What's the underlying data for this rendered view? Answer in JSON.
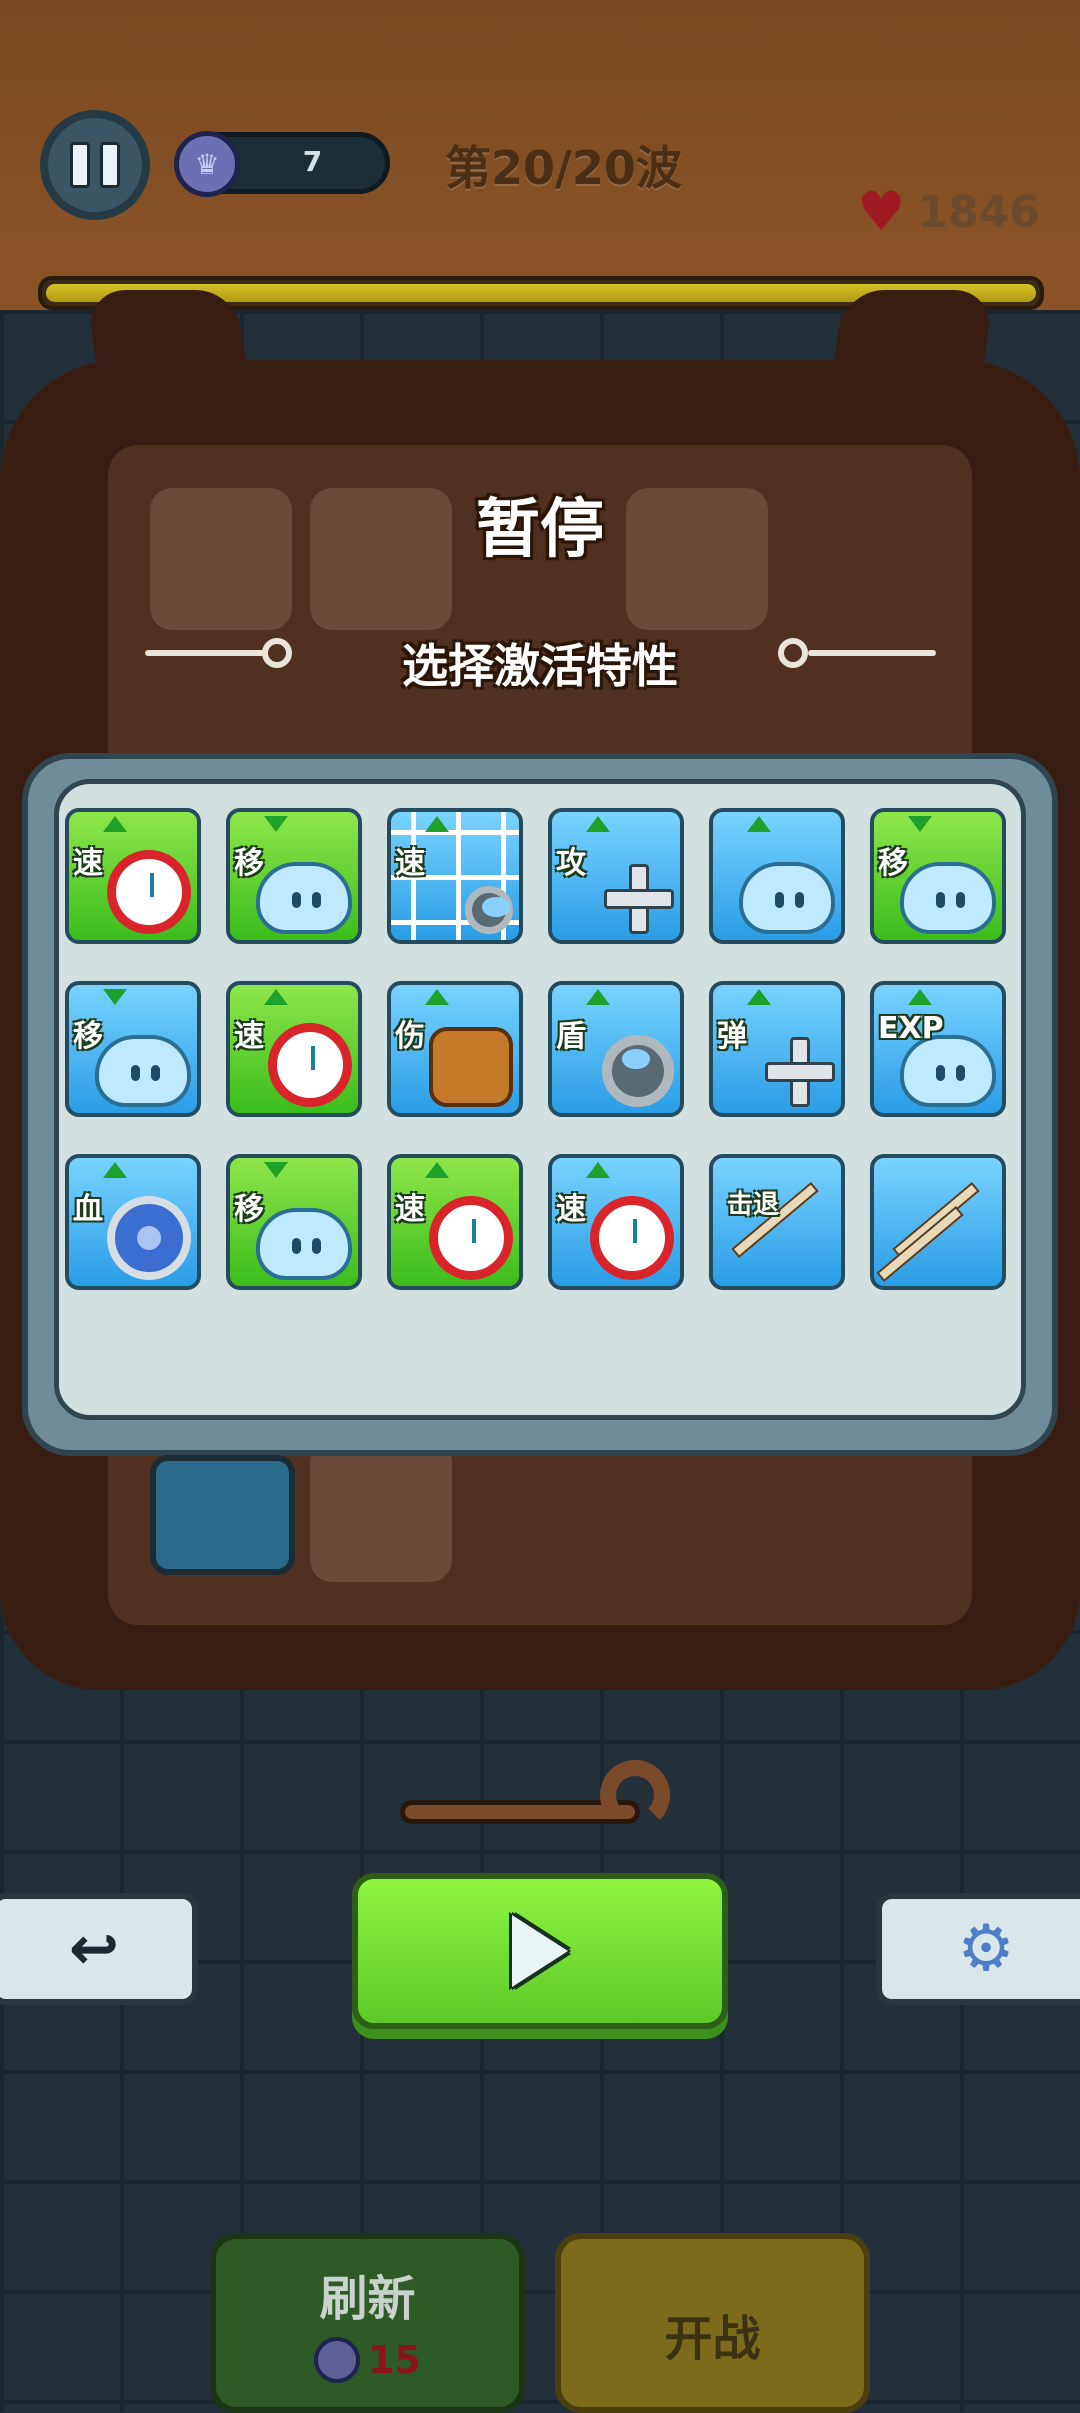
{
  "hud": {
    "crown_count": "7",
    "wave_text": "第20/20波",
    "hp_value": "1846",
    "progress_fraction": 1.0
  },
  "pause_menu": {
    "title": "暂停",
    "subtitle": "选择激活特性"
  },
  "traits": [
    {
      "label": "速",
      "icon": "clock-icon",
      "arrow": "up",
      "color": "green"
    },
    {
      "label": "移",
      "icon": "slime-icon",
      "arrow": "down",
      "color": "green"
    },
    {
      "label": "速",
      "icon": "grid-disc-icon",
      "arrow": "up",
      "color": "blue"
    },
    {
      "label": "攻",
      "icon": "shuriken-icon",
      "arrow": "up",
      "color": "blue"
    },
    {
      "label": "",
      "icon": "coin-slime-icon",
      "arrow": "up",
      "color": "blue"
    },
    {
      "label": "移",
      "icon": "slime-icon",
      "arrow": "down",
      "color": "green"
    },
    {
      "label": "移",
      "icon": "slime-icon",
      "arrow": "down",
      "color": "blue"
    },
    {
      "label": "速",
      "icon": "clock-icon",
      "arrow": "up",
      "color": "green"
    },
    {
      "label": "伤",
      "icon": "backpack-icon",
      "arrow": "up",
      "color": "blue"
    },
    {
      "label": "盾",
      "icon": "ring-icon",
      "arrow": "up",
      "color": "blue"
    },
    {
      "label": "弹",
      "icon": "shuriken-icon",
      "arrow": "up",
      "color": "blue"
    },
    {
      "label": "EXP",
      "icon": "slime-icon",
      "arrow": "up",
      "color": "blue"
    },
    {
      "label": "血",
      "icon": "shield-icon",
      "arrow": "up",
      "color": "blue"
    },
    {
      "label": "移",
      "icon": "slime-icon",
      "arrow": "down",
      "color": "green"
    },
    {
      "label": "速",
      "icon": "clock-icon",
      "arrow": "up",
      "color": "green"
    },
    {
      "label": "速",
      "icon": "clock-icon",
      "arrow": "up",
      "color": "blue"
    },
    {
      "label": "击退",
      "icon": "arrow-icon",
      "arrow": "none",
      "color": "blue"
    },
    {
      "label": "",
      "icon": "double-arrow-icon",
      "arrow": "none",
      "color": "blue"
    }
  ],
  "buttons": {
    "back_icon": "↩",
    "settings_icon": "⚙",
    "refresh_label": "刷新",
    "refresh_cost": "15",
    "fight_label": "开战"
  }
}
